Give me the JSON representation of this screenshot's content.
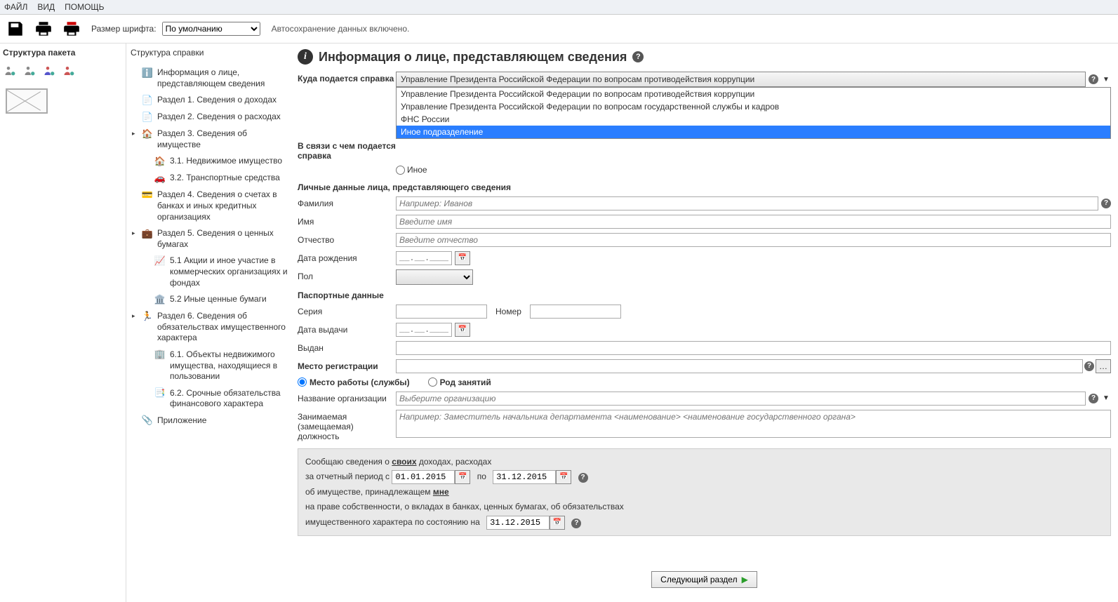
{
  "menu": {
    "file": "ФАЙЛ",
    "view": "ВИД",
    "help": "ПОМОЩЬ"
  },
  "toolbar": {
    "fontsize_label": "Размер шрифта:",
    "fontsize_value": "По умолчанию",
    "autosave": "Автосохранение данных включено."
  },
  "pkg": {
    "title": "Структура пакета"
  },
  "treeTitle": "Структура справки",
  "tree": [
    {
      "label": "Информация о лице, представляющем сведения",
      "icon": "info"
    },
    {
      "label": "Раздел 1. Сведения о доходах",
      "icon": "doc-plus"
    },
    {
      "label": "Раздел 2. Сведения о расходах",
      "icon": "doc-minus"
    },
    {
      "label": "Раздел 3. Сведения об имуществе",
      "icon": "house",
      "caret": true
    },
    {
      "label": "3.1. Недвижимое имущество",
      "icon": "house2",
      "sub": true
    },
    {
      "label": "3.2. Транспортные средства",
      "icon": "car",
      "sub": true
    },
    {
      "label": "Раздел 4. Сведения о счетах в банках и иных кредитных организациях",
      "icon": "card"
    },
    {
      "label": "Раздел 5. Сведения о ценных бумагах",
      "icon": "briefcase",
      "caret": true
    },
    {
      "label": "5.1 Акции и иное участие в коммерческих организациях и фондах",
      "icon": "chart",
      "sub": true
    },
    {
      "label": "5.2 Иные ценные бумаги",
      "icon": "bank",
      "sub": true
    },
    {
      "label": "Раздел 6. Сведения об обязательствах имущественного характера",
      "icon": "person",
      "caret": true
    },
    {
      "label": "6.1. Объекты недвижимого имущества, находящиеся в пользовании",
      "icon": "buildings",
      "sub": true
    },
    {
      "label": "6.2. Срочные обязательства финансового характера",
      "icon": "docs",
      "sub": true
    },
    {
      "label": "Приложение",
      "icon": "attach"
    }
  ],
  "form": {
    "title": "Информация о лице, представляющем сведения",
    "where_label": "Куда подается справка",
    "where_value": "Управление Президента Российской Федерации по вопросам противодействия коррупции",
    "where_options": [
      "Управление Президента Российской Федерации по вопросам противодействия коррупции",
      "Управление Президента Российской Федерации по вопросам государственной службы и кадров",
      "ФНС России",
      "Иное подразделение"
    ],
    "reason_label": "В связи с чем подается справка",
    "other_radio": "Иное",
    "personal_heading": "Личные данные лица, представляющего сведения",
    "surname": "Фамилия",
    "surname_ph": "Например: Иванов",
    "name": "Имя",
    "name_ph": "Введите имя",
    "patronymic": "Отчество",
    "patronymic_ph": "Введите отчество",
    "birthdate": "Дата рождения",
    "date_ph": "__.__.____",
    "gender": "Пол",
    "passport_heading": "Паспортные данные",
    "series": "Серия",
    "number": "Номер",
    "issue_date": "Дата выдачи",
    "issued_by": "Выдан",
    "reg_heading": "Место регистрации",
    "workplace_radio": "Место работы (службы)",
    "occupation_radio": "Род занятий",
    "org_name": "Название организации",
    "org_ph": "Выберите организацию",
    "position": "Занимаемая (замещаемая) должность",
    "position_ph": "Например: Заместитель начальника департамента <наименование> <наименование государственного органа>",
    "summary": {
      "line1a": "Сообщаю сведения о ",
      "line1b": "своих",
      "line1c": " доходах, расходах",
      "line2a": "за отчетный период с",
      "date_from": "01.01.2015",
      "line2b": "по",
      "date_to": "31.12.2015",
      "line3a": "об имуществе, принадлежащем ",
      "line3b": "мне",
      "line4": "на праве собственности, о вкладах в банках, ценных бумагах, об обязательствах",
      "line5a": "имущественного характера по состоянию на",
      "date_asof": "31.12.2015"
    },
    "next": "Следующий раздел"
  }
}
